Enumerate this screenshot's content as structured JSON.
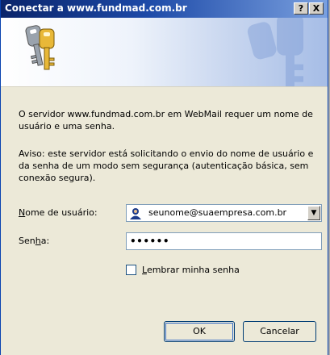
{
  "window": {
    "title": "Conectar a www.fundmad.com.br",
    "help_label": "?",
    "close_label": "X"
  },
  "banner": {
    "icon": "keys-icon",
    "watermark": "keys-icon"
  },
  "message": {
    "intro": "O servidor www.fundmad.com.br em WebMail requer um nome de usuário e uma senha.",
    "warning": "Aviso: este servidor está solicitando o envio do nome de usuário e da senha de um modo sem segurança (autenticação básica, sem conexão segura)."
  },
  "form": {
    "username_label_prefix": "N",
    "username_label_rest": "ome de usuário:",
    "username_value": "seunome@suaempresa.com.br",
    "username_icon": "user-icon",
    "password_label_prefix": "Sen",
    "password_label_key": "h",
    "password_label_rest": "a:",
    "password_value": "••••••",
    "remember_key": "L",
    "remember_rest": "embrar minha senha"
  },
  "buttons": {
    "ok": "OK",
    "cancel": "Cancelar"
  }
}
